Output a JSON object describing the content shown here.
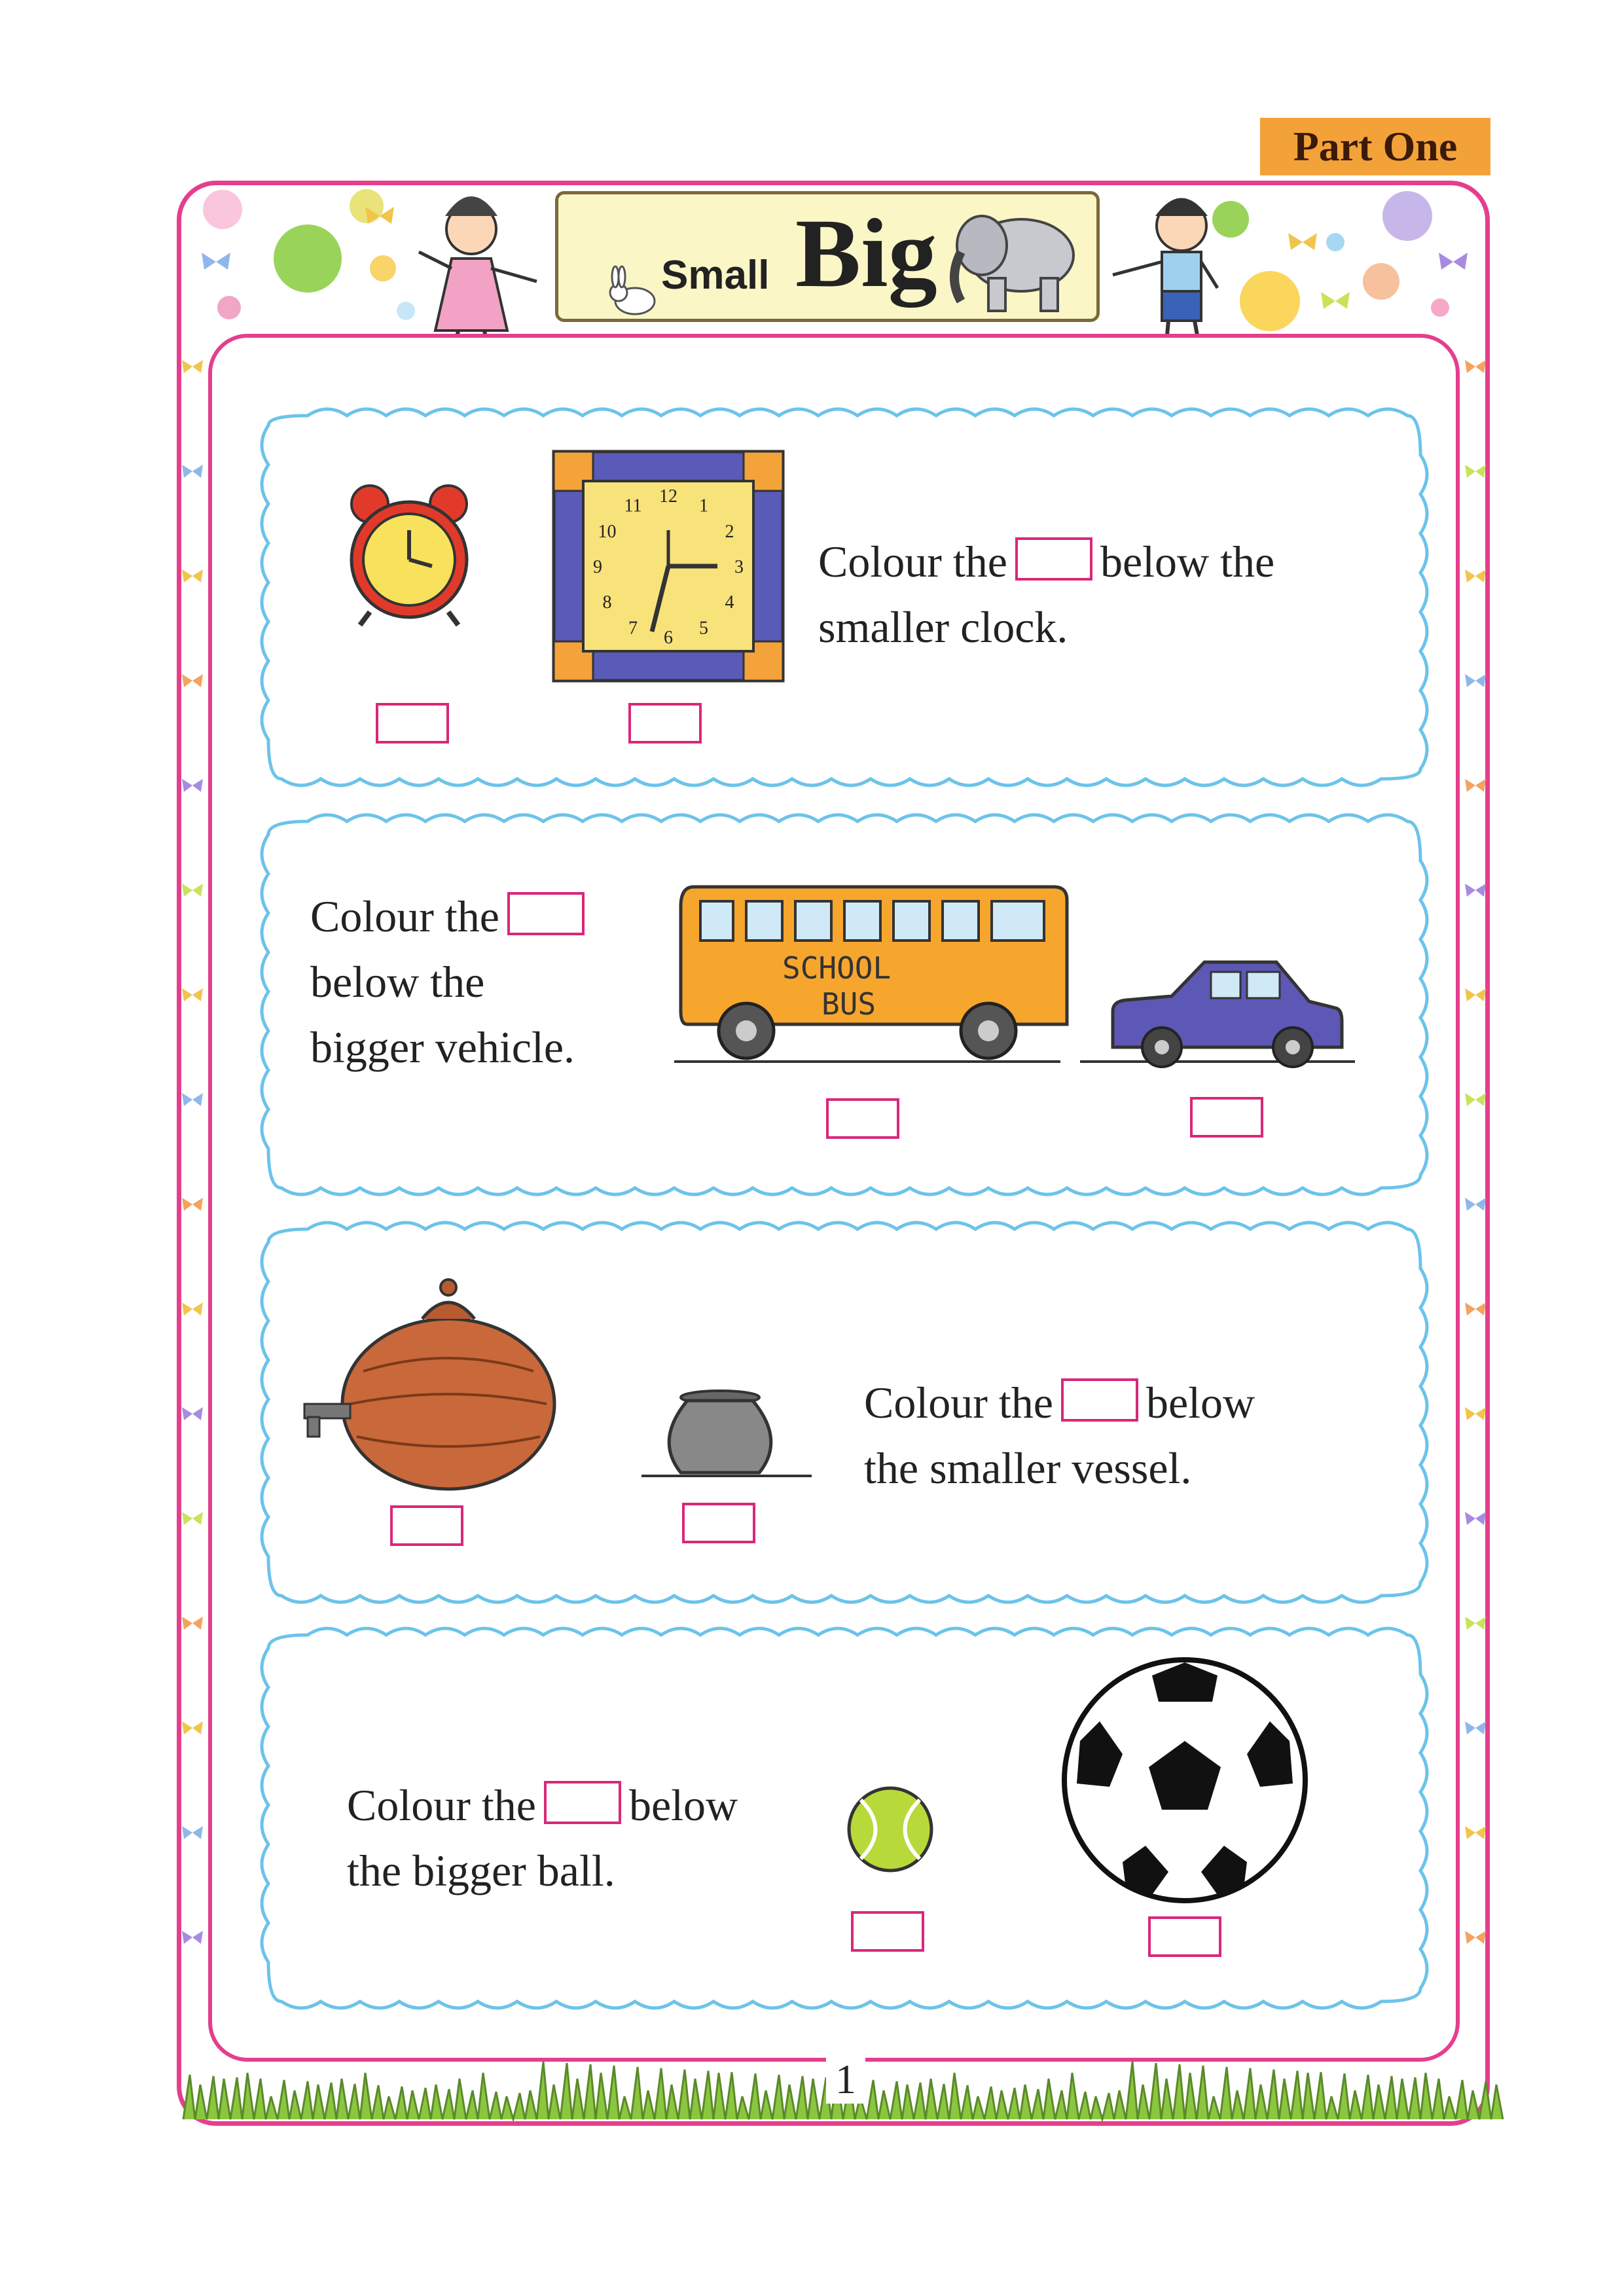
{
  "part_label": "Part One",
  "title": {
    "small": "Small",
    "big": "Big"
  },
  "page_number": "1",
  "exercises": [
    {
      "line1_pre": "Colour the",
      "line1_post": "below the",
      "line2": "smaller clock."
    },
    {
      "line1_pre": "Colour the",
      "line2": "below the",
      "line3": "bigger vehicle."
    },
    {
      "line1_pre": "Colour the",
      "line1_post": "below",
      "line2": "the smaller vessel."
    },
    {
      "line1_pre": "Colour the",
      "line1_post": "below",
      "line2": "the bigger ball."
    }
  ],
  "bus_sign": {
    "line1": "SCHOOL",
    "line2": "BUS"
  },
  "clock_numbers": [
    "12",
    "1",
    "2",
    "3",
    "4",
    "5",
    "6",
    "7",
    "8",
    "9",
    "10",
    "11"
  ],
  "colors": {
    "frame": "#e43f8e",
    "wave": "#6cc3ea",
    "tag": "#f3a23a",
    "grass": "#8cc63f"
  }
}
